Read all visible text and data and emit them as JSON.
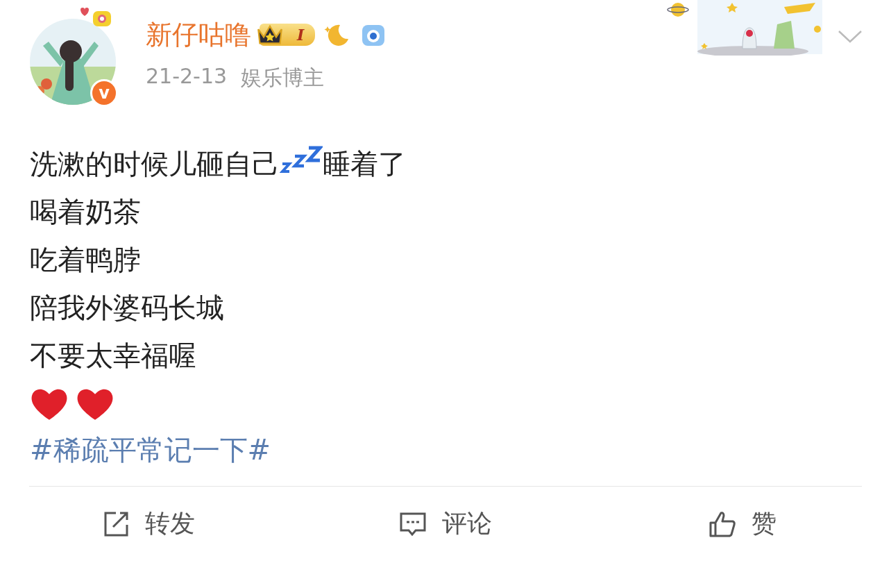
{
  "post": {
    "author": {
      "name": "新仔咕噜",
      "level_badge": "I",
      "verified": true,
      "verify_mark": "v"
    },
    "date": "21-2-13",
    "category": "娱乐博主",
    "lines": [
      [
        {
          "kind": "text",
          "text": "洗漱的时候儿砸自己"
        },
        {
          "kind": "sleep"
        },
        {
          "kind": "text",
          "text": "睡着了"
        }
      ],
      [
        {
          "kind": "text",
          "text": "喝着奶茶"
        }
      ],
      [
        {
          "kind": "text",
          "text": "吃着鸭脖"
        }
      ],
      [
        {
          "kind": "text",
          "text": "陪我外婆码长城"
        }
      ],
      [
        {
          "kind": "text",
          "text": "不要太幸福喔"
        }
      ],
      [
        {
          "kind": "heart"
        },
        {
          "kind": "heart"
        }
      ]
    ],
    "hashtag": "#稀疏平常记一下#"
  },
  "actions": [
    {
      "kind": "repost",
      "label": "转发"
    },
    {
      "kind": "comment",
      "label": "评论"
    },
    {
      "kind": "like",
      "label": "赞"
    }
  ]
}
